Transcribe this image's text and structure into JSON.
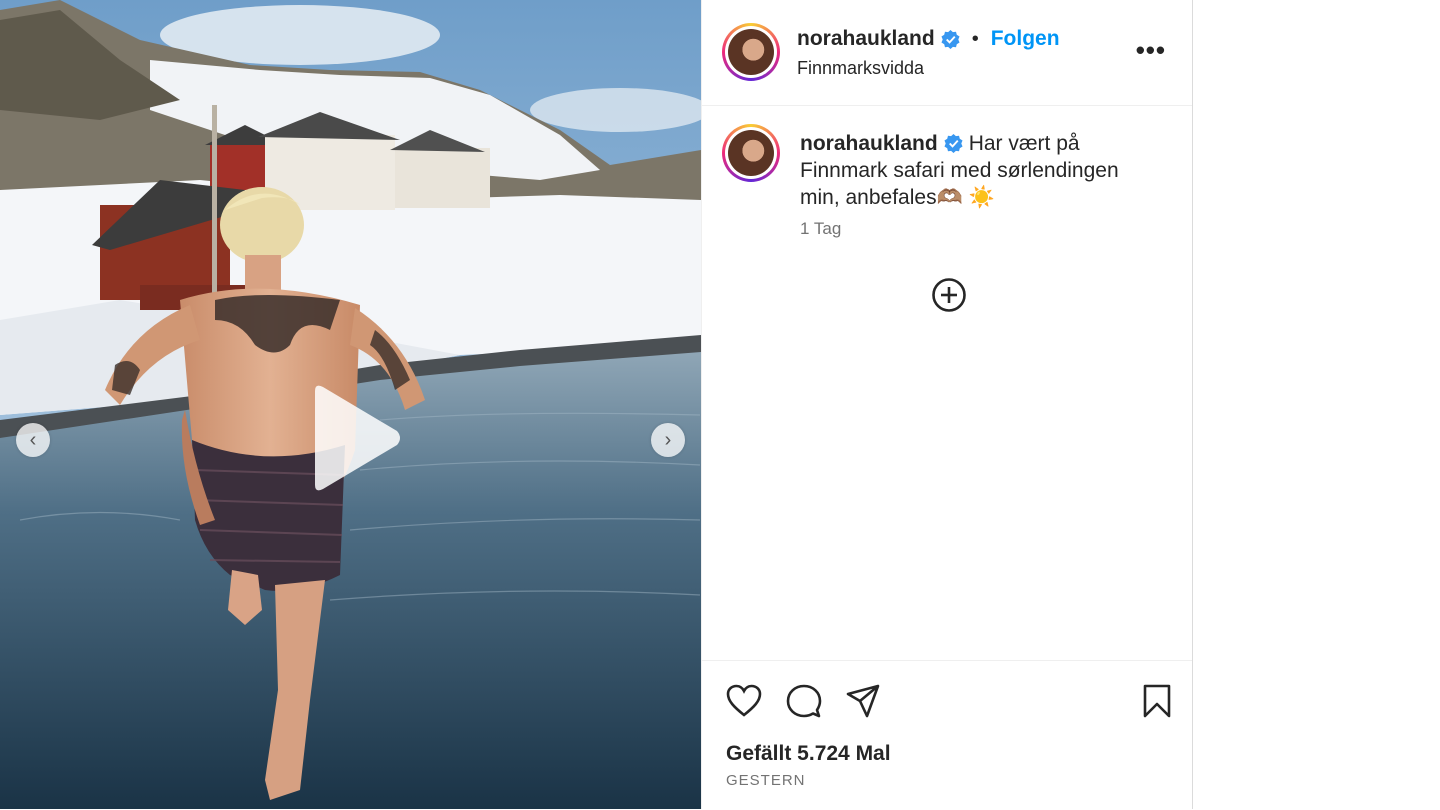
{
  "post": {
    "username": "norahaukland",
    "separator": "•",
    "follow_label": "Folgen",
    "location": "Finnmarksvidda",
    "more_label": "•••",
    "caption_text": "Har vært på Finnmark safari med sørlendingen min, anbefales🫶🏽 ☀️",
    "time_ago": "1 Tag",
    "likes_text": "Gefällt 5.724 Mal",
    "date_label": "GESTERN"
  },
  "media": {
    "prev_label": "‹",
    "next_label": "›"
  },
  "icons": {
    "verified": "verified-badge-icon",
    "play": "play-icon",
    "add": "add-comment-icon",
    "like": "heart-icon",
    "comment": "comment-icon",
    "share": "share-icon",
    "save": "bookmark-icon"
  },
  "colors": {
    "accent": "#0095f6",
    "text": "#262626",
    "muted": "#737373"
  }
}
